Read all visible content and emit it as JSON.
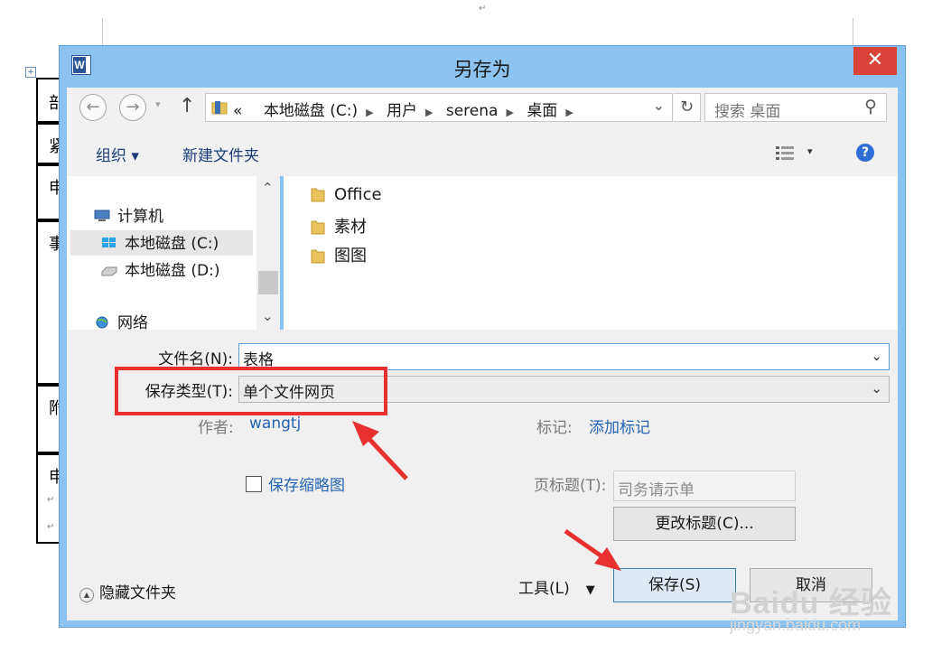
{
  "dialog": {
    "title": "另存为",
    "close_glyph": "✕",
    "app_icon_letter": "W"
  },
  "nav": {
    "back_glyph": "←",
    "forward_glyph": "→",
    "up_glyph": "↑",
    "breadcrumb_prefix": "«",
    "breadcrumbs": [
      "本地磁盘 (C:)",
      "用户",
      "serena",
      "桌面"
    ],
    "search_placeholder": "搜索 桌面"
  },
  "toolbar": {
    "organize": "组织 ▾",
    "new_folder": "新建文件夹",
    "help": "?"
  },
  "navpane": {
    "computer": "计算机",
    "drive_c": "本地磁盘 (C:)",
    "drive_d": "本地磁盘 (D:)",
    "network": "网络"
  },
  "files": [
    {
      "name": "Office"
    },
    {
      "name": "素材"
    },
    {
      "name": "图图"
    }
  ],
  "form": {
    "filename_label": "文件名(N):",
    "filename_value": "表格",
    "type_label": "保存类型(T):",
    "type_value": "单个文件网页",
    "author_label": "作者:",
    "author_value": "wangtj",
    "tags_label": "标记:",
    "tags_value": "添加标记",
    "thumbnail_label": "保存缩略图",
    "page_title_label": "页标题(T):",
    "page_title_value": "司务请示单",
    "change_title_button": "更改标题(C)...",
    "hide_folders": "隐藏文件夹",
    "tools": "工具(L)",
    "save_button": "保存(S)",
    "cancel_button": "取消"
  },
  "document": {
    "cell_chars": [
      "部",
      "紧",
      "申",
      "事",
      "附",
      "申"
    ]
  },
  "watermark": {
    "line1": "Baidu 经验",
    "line2": "jingyan.baidu.com"
  },
  "colors": {
    "title_bar": "#8dc3f1",
    "close_button": "#d9433a",
    "link_blue": "#2464b3",
    "annotation_red": "#e83030"
  }
}
